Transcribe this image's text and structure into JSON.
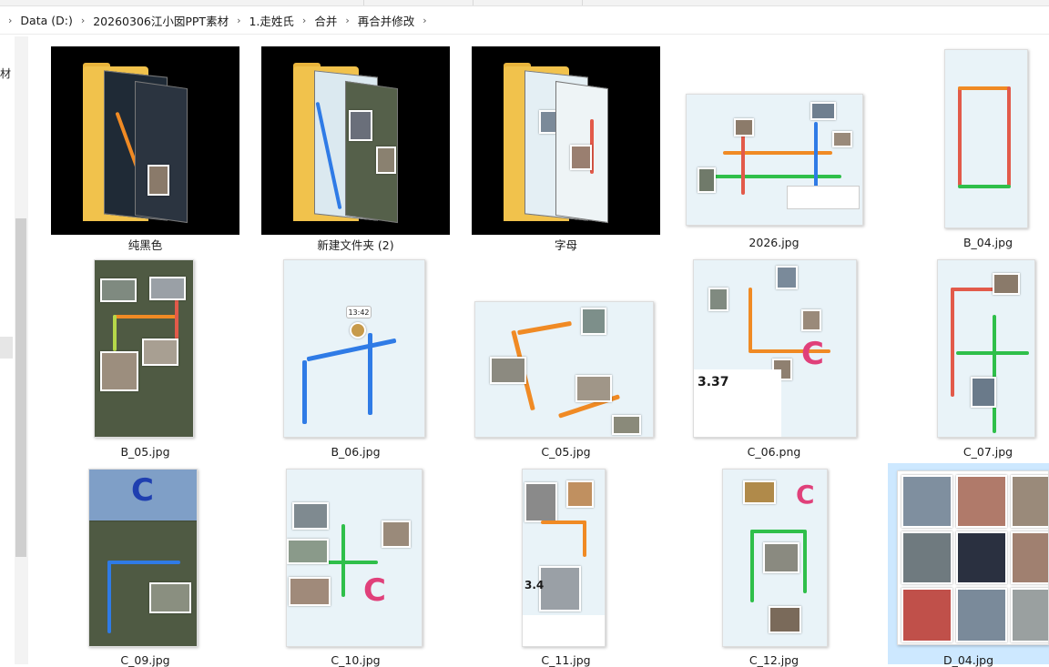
{
  "address_bar": {
    "crumbs": [
      "Data (D:)",
      "20260306江小囡PPT素材",
      "1.走姓氏",
      "合并",
      "再合并修改"
    ]
  },
  "left_pane": {
    "partial_text": "材"
  },
  "items": [
    {
      "name": "纯黑色",
      "type": "folder"
    },
    {
      "name": "新建文件夹 (2)",
      "type": "folder"
    },
    {
      "name": "字母",
      "type": "folder"
    },
    {
      "name": "2026.jpg",
      "type": "image"
    },
    {
      "name": "B_04.jpg",
      "type": "image"
    },
    {
      "name": "B_05.jpg",
      "type": "image"
    },
    {
      "name": "B_06.jpg",
      "type": "image"
    },
    {
      "name": "C_05.jpg",
      "type": "image"
    },
    {
      "name": "C_06.png",
      "type": "image"
    },
    {
      "name": "C_07.jpg",
      "type": "image"
    },
    {
      "name": "C_09.jpg",
      "type": "image"
    },
    {
      "name": "C_10.jpg",
      "type": "image"
    },
    {
      "name": "C_11.jpg",
      "type": "image"
    },
    {
      "name": "C_12.jpg",
      "type": "image"
    },
    {
      "name": "D_04.jpg",
      "type": "image",
      "selected": true
    }
  ],
  "thumb_text": {
    "b06_time": "13:42",
    "c06_distance": "3.37",
    "c11_distance": "3.4",
    "letter": "C"
  },
  "colors": {
    "selection": "#cde8ff",
    "folder": "#f1c24c",
    "route_orange": "#f08a24",
    "route_blue": "#2f7be6",
    "route_green": "#2fbf4a",
    "letter_pink": "#e0407a"
  }
}
